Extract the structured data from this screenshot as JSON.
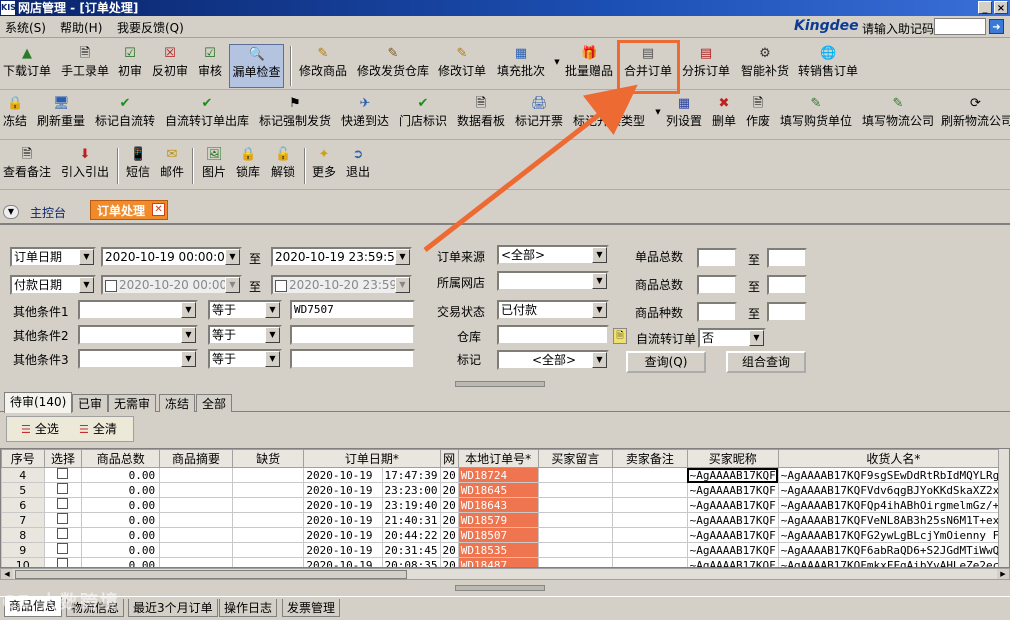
{
  "window": {
    "app_icon": "KIS",
    "title": "网店管理 - [订单处理]",
    "controls": [
      "_",
      "×"
    ]
  },
  "menubar": {
    "items": [
      "系统(S)",
      "帮助(H)",
      "我要反馈(Q)"
    ],
    "brand": "Kingdee",
    "hint_label": "请输入助记码",
    "hint_value": "",
    "go_icon": "arrow-right-icon"
  },
  "toolbar1": [
    {
      "label": "下载订单",
      "icon": "download-order-icon"
    },
    {
      "label": "手工录单",
      "icon": "manual-entry-icon"
    },
    {
      "label": "初审",
      "icon": "first-review-icon"
    },
    {
      "label": "反初审",
      "icon": "reverse-first-review-icon"
    },
    {
      "label": "审核",
      "icon": "audit-icon"
    },
    {
      "label": "漏单检查",
      "icon": "missing-order-check-icon",
      "pressed": true
    },
    {
      "label": "修改商品",
      "icon": "edit-goods-icon"
    },
    {
      "label": "修改发货仓库",
      "icon": "edit-warehouse-icon"
    },
    {
      "label": "修改订单",
      "icon": "edit-order-icon"
    },
    {
      "label": "填充批次",
      "icon": "fill-batch-icon"
    },
    {
      "label": "批量赠品",
      "icon": "batch-gift-icon"
    },
    {
      "label": "合并订单",
      "icon": "merge-order-icon",
      "highlighted": true
    },
    {
      "label": "分拆订单",
      "icon": "split-order-icon"
    },
    {
      "label": "智能补货",
      "icon": "smart-restock-icon"
    },
    {
      "label": "转销售订单",
      "icon": "to-sales-order-icon"
    }
  ],
  "toolbar2": [
    {
      "label": "冻结",
      "icon": "lock-icon"
    },
    {
      "label": "刷新重量",
      "icon": "refresh-weight-icon"
    },
    {
      "label": "标记自流转",
      "icon": "checkmark-icon"
    },
    {
      "label": "自流转订单出库",
      "icon": "checkmark-icon"
    },
    {
      "label": "标记强制发货",
      "icon": "flag-icon"
    },
    {
      "label": "快递到达",
      "icon": "courier-arrival-icon"
    },
    {
      "label": "门店标识",
      "icon": "checkmark-icon"
    },
    {
      "label": "数据看板",
      "icon": "dashboard-icon"
    },
    {
      "label": "标记开票",
      "icon": "invoice-mark-icon"
    },
    {
      "label": "标记开票类型",
      "icon": "invoice-type-icon"
    },
    {
      "label": "列设置",
      "icon": "column-settings-icon"
    },
    {
      "label": "删单",
      "icon": "delete-x-icon"
    },
    {
      "label": "作废",
      "icon": "void-icon"
    },
    {
      "label": "填写购货单位",
      "icon": "fill-buyer-icon"
    },
    {
      "label": "填写物流公司",
      "icon": "fill-logistics-icon"
    },
    {
      "label": "刷新物流公司",
      "icon": "refresh-logistics-icon"
    }
  ],
  "toolbar3": [
    {
      "label": "查看备注",
      "icon": "view-note-icon"
    },
    {
      "label": "引入引出",
      "icon": "import-export-icon"
    },
    {
      "label": "短信",
      "icon": "sms-icon"
    },
    {
      "label": "邮件",
      "icon": "mail-icon"
    },
    {
      "label": "图片",
      "icon": "image-icon"
    },
    {
      "label": "锁库",
      "icon": "lock-stock-icon"
    },
    {
      "label": "解锁",
      "icon": "unlock-icon"
    },
    {
      "label": "更多",
      "icon": "more-icon"
    },
    {
      "label": "退出",
      "icon": "exit-icon"
    }
  ],
  "nav": {
    "home": "主控台",
    "open_tab": "订单处理"
  },
  "filters": {
    "date_type1": "订单日期",
    "date1_from": "2020-10-19 00:00:00",
    "to": "至",
    "date1_to": "2020-10-19 23:59:59",
    "date_type2": "付款日期",
    "date2_from": "2020-10-20 00:00:0",
    "date2_to": "2020-10-20 23:59:5",
    "other1_label": "其他条件1",
    "other2_label": "其他条件2",
    "other3_label": "其他条件3",
    "op": "等于",
    "other1_value": "WD7507",
    "source_label": "订单来源",
    "source_value": "<全部>",
    "shop_label": "所属网店",
    "shop_value": "",
    "status_label": "交易状态",
    "status_value": "已付款",
    "warehouse_label": "仓库",
    "mark_label": "标记",
    "mark_value": "<全部>",
    "auto_flow_label": "自流转订单",
    "auto_flow_value": "否",
    "single_total_label": "单品总数",
    "goods_total_label": "商品总数",
    "goods_kinds_label": "商品种数",
    "query_btn": "查询(Q)",
    "combo_query_btn": "组合查询"
  },
  "tabs": [
    "待审(140)",
    "已审",
    "无需审",
    "冻结",
    "全部"
  ],
  "subtoolbar": {
    "select_all": "全选",
    "clear_all": "全清"
  },
  "grid": {
    "columns": [
      "序号",
      "选择",
      "商品总数",
      "商品摘要",
      "缺货",
      "订单日期*",
      "网",
      "本地订单号*",
      "买家留言",
      "卖家备注",
      "买家昵称",
      "收货人名*"
    ],
    "rows": [
      {
        "no": "4",
        "total": "0.00",
        "date": "2020-10-19",
        "time": "17:47:39",
        "net": "20",
        "order": "WD18724",
        "nick": "~AgAAAAB17KQF",
        "receiver": "~AgAAAAB17KQF9sgSEwDdRtRbIdMQYLRg"
      },
      {
        "no": "5",
        "total": "0.00",
        "date": "2020-10-19",
        "time": "23:23:00",
        "net": "20",
        "order": "WD18645",
        "nick": "~AgAAAAB17KQF",
        "receiver": "~AgAAAAB17KQFVdv6qgBJYoKKdSkaXZ2x"
      },
      {
        "no": "6",
        "total": "0.00",
        "date": "2020-10-19",
        "time": "23:19:40",
        "net": "20",
        "order": "WD18643",
        "nick": "~AgAAAAB17KQF",
        "receiver": "~AgAAAAB17KQFQp4ihABhOirgmelmGz/+"
      },
      {
        "no": "7",
        "total": "0.00",
        "date": "2020-10-19",
        "time": "21:40:31",
        "net": "20",
        "order": "WD18579",
        "nick": "~AgAAAAB17KQF",
        "receiver": "~AgAAAAB17KQFVeNL8AB3h25sN6M1T+ex"
      },
      {
        "no": "8",
        "total": "0.00",
        "date": "2020-10-19",
        "time": "20:44:22",
        "net": "20",
        "order": "WD18507",
        "nick": "~AgAAAAB17KQF",
        "receiver": "~AgAAAAB17KQFG2ywLgBLcjYmOienny F8"
      },
      {
        "no": "9",
        "total": "0.00",
        "date": "2020-10-19",
        "time": "20:31:45",
        "net": "20",
        "order": "WD18535",
        "nick": "~AgAAAAB17KQF",
        "receiver": "~AgAAAAB17KQF6abRaQD6+S2JGdMTiWwQ"
      },
      {
        "no": "10",
        "total": "0.00",
        "date": "2020-10-19",
        "time": "20:08:35",
        "net": "20",
        "order": "WD18487",
        "nick": "~AgAAAAB17KQF",
        "receiver": "~AgAAAAB17KQFmkxFFgAibYvAHLeZe2ec"
      }
    ]
  },
  "bottom_tabs": [
    "商品信息",
    "物流信息",
    "最近3个月订单",
    "操作日志",
    "发票管理"
  ],
  "watermark": "CE 大数跨境",
  "colors": {
    "highlight_box": "#ee6a33",
    "order_cell": "#ee7550",
    "title_bar": "#0a246a"
  }
}
